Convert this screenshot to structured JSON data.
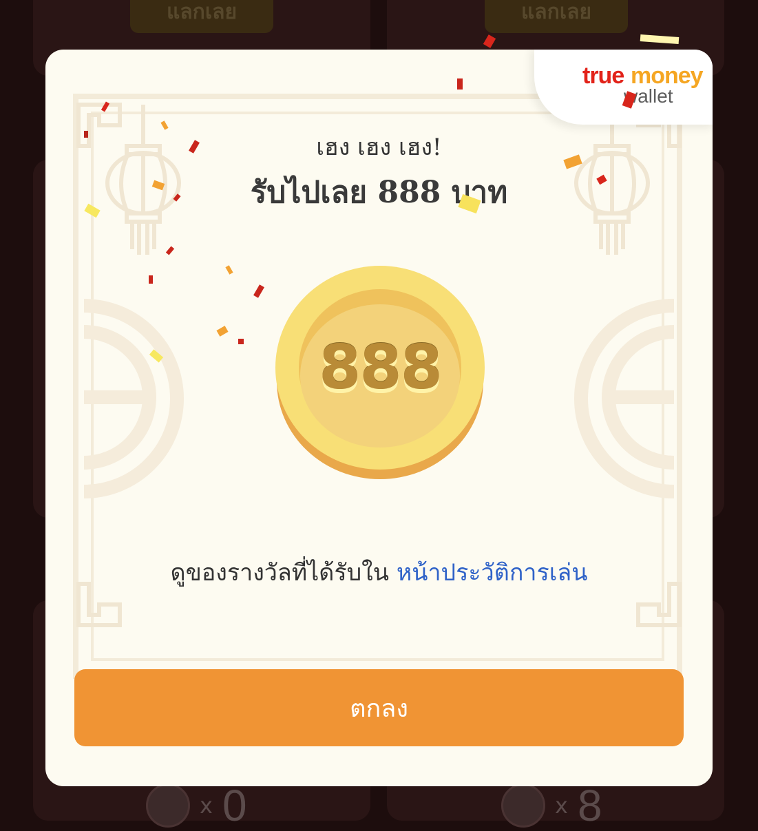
{
  "background": {
    "redeem_left": "แลกเลย",
    "redeem_right": "แลกเลย",
    "counter_left": {
      "x": "x",
      "value": "0"
    },
    "counter_right": {
      "x": "x",
      "value": "8"
    }
  },
  "brand": {
    "logo_true": "true",
    "logo_money": "money",
    "logo_wallet": "wallet"
  },
  "modal": {
    "subtitle": "เฮง เฮง เฮง!",
    "title": "รับไปเลย 888 บาท",
    "coin_value": "888",
    "history_text": "ดูของรางวัลที่ได้รับใน ",
    "history_link": "หน้าประวัติการเล่น",
    "ok_button": "ตกลง"
  },
  "colors": {
    "backdrop": "#1d0d0d",
    "modal_bg": "#fdfbf1",
    "button": "#f09434",
    "link": "#2f62c8",
    "coin": "#f7d365"
  }
}
